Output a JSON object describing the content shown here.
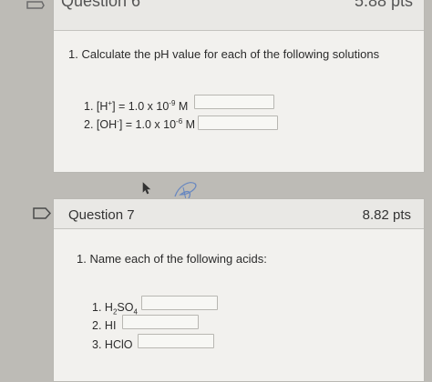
{
  "question6": {
    "title": "Question 6",
    "points": "5.88 pts",
    "prompt": "1. Calculate the pH value for each of the following solutions",
    "items": [
      {
        "num": "1.",
        "pre": "[H",
        "sup1": "+",
        "mid": "] = 1.0 x 10",
        "sup2": "-9",
        "post": " M"
      },
      {
        "num": "2.",
        "pre": "[OH",
        "sup1": "-",
        "mid": "] = 1.0 x 10",
        "sup2": "-6",
        "post": " M"
      }
    ]
  },
  "question7": {
    "title": "Question 7",
    "points": "8.82 pts",
    "prompt": "1. Name each of the following acids:",
    "items": [
      {
        "num": "1.",
        "a": "H",
        "sub1": "2",
        "b": "SO",
        "sub2": "4"
      },
      {
        "num": "2.",
        "label": "HI"
      },
      {
        "num": "3.",
        "label": "HClO"
      }
    ]
  }
}
